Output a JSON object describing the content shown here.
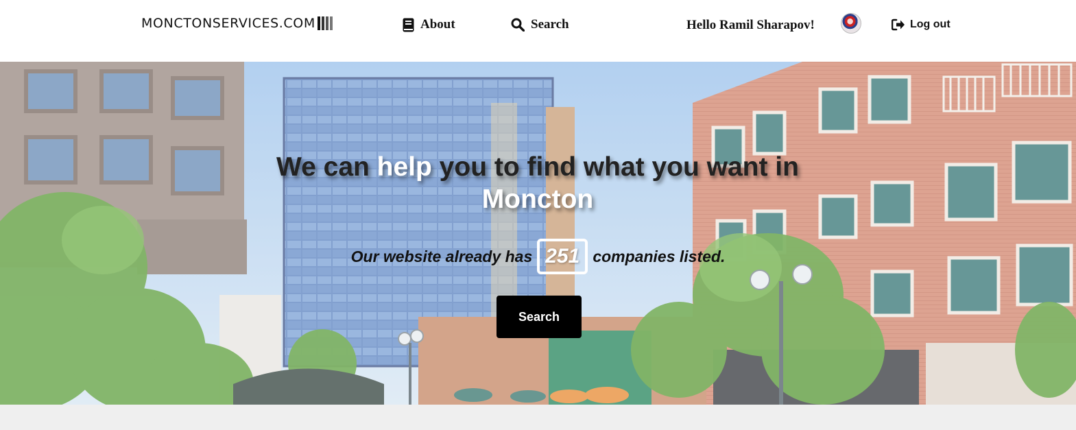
{
  "header": {
    "logo_text": "MONCTONSERVICES.COM",
    "nav": {
      "about_label": "About",
      "about_icon": "book-icon",
      "search_label": "Search",
      "search_icon": "search-icon"
    },
    "greeting": "Hello Ramil Sharapov!",
    "logout_label": "Log out",
    "logout_icon": "sign-out-icon"
  },
  "hero": {
    "headline_part1": "We can ",
    "headline_highlight": "help",
    "headline_part2": " you to find what you want in",
    "headline_city": "Moncton",
    "stats_prefix": "Our website already has",
    "company_count": "251",
    "stats_suffix": "companies listed.",
    "search_button_label": "Search"
  },
  "colors": {
    "header_bg": "#ffffff",
    "button_bg": "#000000",
    "page_bg": "#efefef",
    "highlight_text": "#ffffff"
  }
}
